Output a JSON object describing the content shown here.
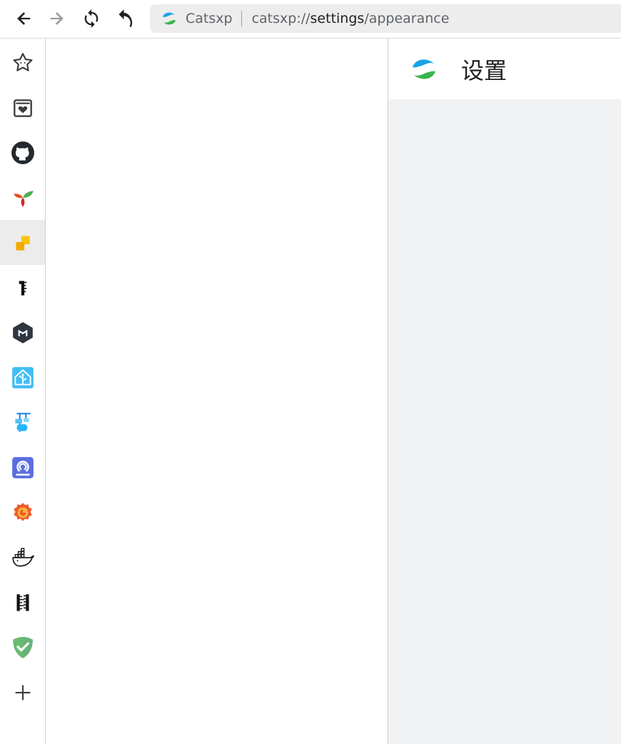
{
  "toolbar": {
    "back_icon": "back-arrow-icon",
    "forward_icon": "forward-arrow-icon",
    "reload_icon": "reload-icon",
    "undo_icon": "undo-icon"
  },
  "address_bar": {
    "site_name": "Catsxp",
    "url_scheme": "catsxp://",
    "url_host": "settings",
    "url_path": "/appearance"
  },
  "sidebar": {
    "items": [
      {
        "icon": "star-icon",
        "active": false
      },
      {
        "icon": "bookmark-heart-icon",
        "active": false
      },
      {
        "icon": "github-icon",
        "active": false
      },
      {
        "icon": "plant-sprout-icon",
        "active": false
      },
      {
        "icon": "yellow-blocks-icon",
        "active": true
      },
      {
        "icon": "ruler-one-icon",
        "active": false
      },
      {
        "icon": "mikrotik-cube-icon",
        "active": false
      },
      {
        "icon": "home-assistant-icon",
        "active": false
      },
      {
        "icon": "crane-container-icon",
        "active": false
      },
      {
        "icon": "openwrt-icon",
        "active": false
      },
      {
        "icon": "grafana-icon",
        "active": false
      },
      {
        "icon": "docker-whale-icon",
        "active": false
      },
      {
        "icon": "ruler-bars-icon",
        "active": false
      },
      {
        "icon": "shield-check-icon",
        "active": false
      },
      {
        "icon": "plus-icon",
        "active": false
      }
    ]
  },
  "settings": {
    "title": "设置"
  },
  "colors": {
    "accent_blue": "#1aa3e8",
    "accent_green": "#39b54a",
    "panel_bg": "#f1f2f4"
  }
}
